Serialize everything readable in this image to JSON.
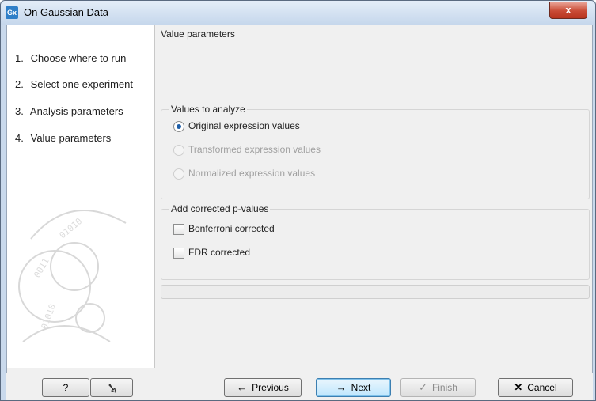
{
  "window": {
    "title": "On Gaussian Data",
    "close_glyph": "x"
  },
  "steps": [
    {
      "num": "1.",
      "label": "Choose where to run"
    },
    {
      "num": "2.",
      "label": "Select one experiment"
    },
    {
      "num": "3.",
      "label": "Analysis parameters"
    },
    {
      "num": "4.",
      "label": "Value parameters"
    }
  ],
  "content": {
    "title": "Value parameters",
    "values_group": {
      "title": "Values to analyze",
      "options": [
        {
          "label": "Original expression values",
          "selected": true,
          "enabled": true
        },
        {
          "label": "Transformed expression values",
          "selected": false,
          "enabled": false
        },
        {
          "label": "Normalized expression values",
          "selected": false,
          "enabled": false
        }
      ]
    },
    "pvalues_group": {
      "title": "Add corrected p-values",
      "options": [
        {
          "label": "Bonferroni corrected",
          "checked": false
        },
        {
          "label": "FDR corrected",
          "checked": false
        }
      ]
    }
  },
  "buttons": {
    "help": "?",
    "reset_icon": "undo-arrow-icon",
    "previous": "Previous",
    "next": "Next",
    "finish": "Finish",
    "cancel": "Cancel"
  },
  "colors": {
    "accent": "#1e5ea8",
    "close": "#c94a35",
    "frame": "#c9d9ec"
  }
}
